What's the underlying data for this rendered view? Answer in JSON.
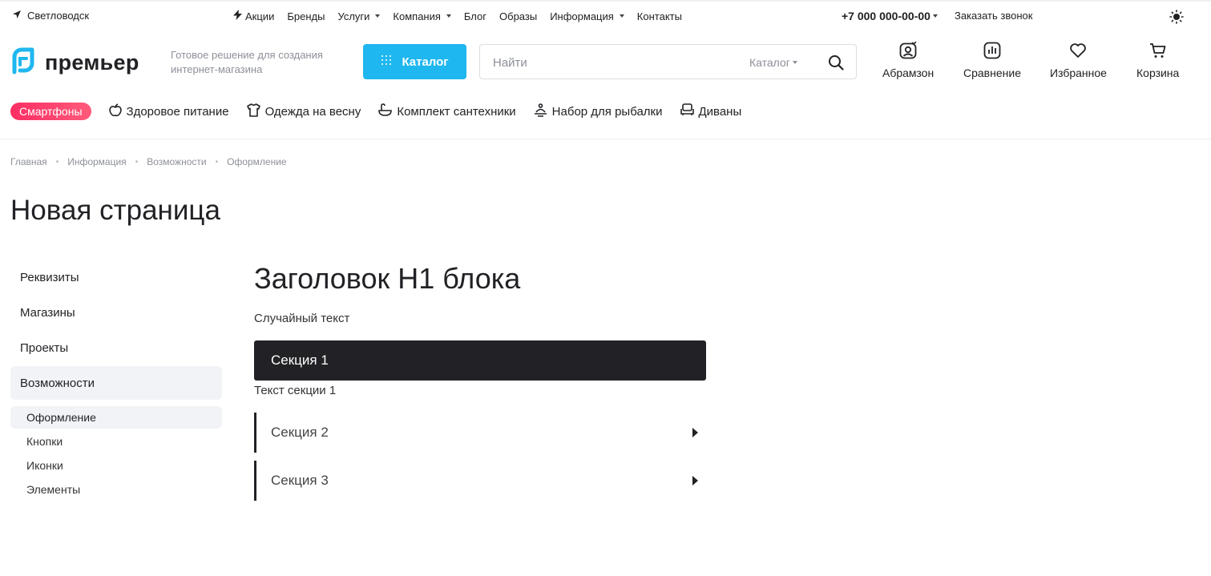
{
  "topbar": {
    "city": "Светловодск",
    "nav": [
      {
        "label": "Акции",
        "icon": "lightning-icon"
      },
      {
        "label": "Бренды"
      },
      {
        "label": "Услуги",
        "dropdown": true
      },
      {
        "label": "Компания",
        "dropdown": true
      },
      {
        "label": "Блог"
      },
      {
        "label": "Образы"
      },
      {
        "label": "Информация",
        "dropdown": true
      },
      {
        "label": "Контакты"
      }
    ],
    "phone": "+7 000 000-00-00",
    "callback": "Заказать звонок"
  },
  "header": {
    "logo": "премьер",
    "tagline": "Готовое решение для создания интернет-магазина",
    "catalog_button": "Каталог",
    "search": {
      "placeholder": "Найти",
      "scope": "Каталог"
    },
    "icons": [
      {
        "label": "Абрамзон",
        "icon": "user-icon"
      },
      {
        "label": "Сравнение",
        "icon": "compare-icon"
      },
      {
        "label": "Избранное",
        "icon": "heart-icon"
      },
      {
        "label": "Корзина",
        "icon": "cart-icon"
      }
    ]
  },
  "categories": {
    "badge": "Смартфоны",
    "items": [
      {
        "label": "Здоровое питание",
        "icon": "apple-icon"
      },
      {
        "label": "Одежда на весну",
        "icon": "shirt-icon"
      },
      {
        "label": "Комплект сантехники",
        "icon": "bath-icon"
      },
      {
        "label": "Набор для рыбалки",
        "icon": "fishing-icon"
      },
      {
        "label": "Диваны",
        "icon": "sofa-icon"
      }
    ]
  },
  "breadcrumb": [
    "Главная",
    "Информация",
    "Возможности",
    "Оформление"
  ],
  "page_title": "Новая страница",
  "sidebar": {
    "items": [
      "Реквизиты",
      "Магазины",
      "Проекты",
      "Возможности"
    ],
    "active": "Возможности",
    "subitems": [
      "Оформление",
      "Кнопки",
      "Иконки",
      "Элементы"
    ],
    "active_sub": "Оформление"
  },
  "content": {
    "heading": "Заголовок H1 блока",
    "text": "Случайный текст",
    "sections": [
      {
        "title": "Секция 1",
        "text": "Текст секции 1",
        "open": true
      },
      {
        "title": "Секция 2",
        "open": false
      },
      {
        "title": "Секция 3",
        "open": false
      }
    ]
  },
  "colors": {
    "accent": "#1fb7ef",
    "badge": "#ff2e63",
    "dark": "#222226"
  }
}
